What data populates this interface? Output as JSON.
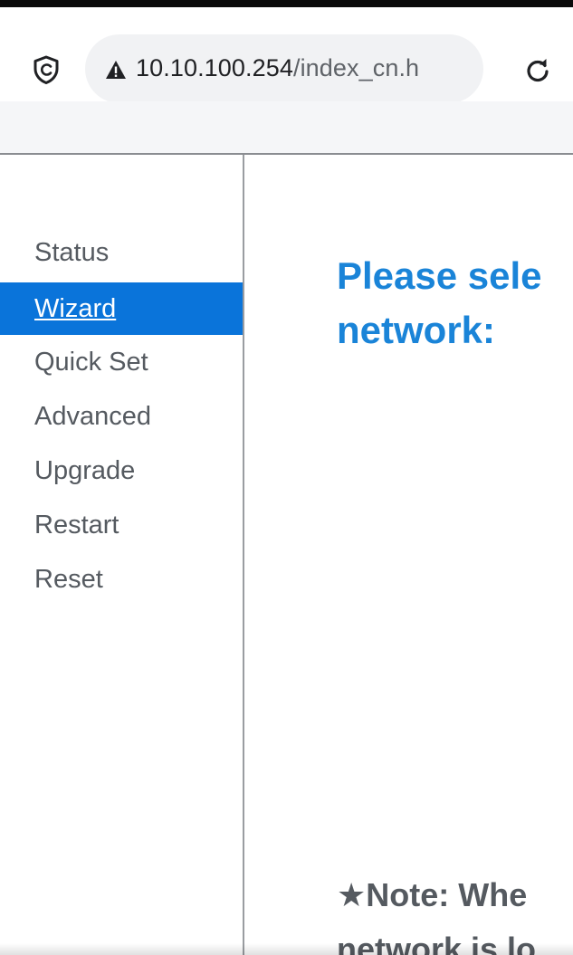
{
  "browser": {
    "url_host": "10.10.100.254",
    "url_path": "/index_cn.h",
    "security_icon": "shield-icon",
    "warning_icon": "warning-triangle-icon",
    "reload_icon": "reload-icon"
  },
  "sidebar": {
    "items": [
      {
        "label": "Status",
        "active": false
      },
      {
        "label": "Wizard",
        "active": true
      },
      {
        "label": "Quick Set",
        "active": false
      },
      {
        "label": "Advanced",
        "active": false
      },
      {
        "label": "Upgrade",
        "active": false
      },
      {
        "label": "Restart",
        "active": false
      },
      {
        "label": "Reset",
        "active": false
      }
    ]
  },
  "main": {
    "title_line1": "Please sele",
    "title_line2": "network:",
    "note_line1": "★Note: Whe",
    "note_line2": "network is lo"
  },
  "colors": {
    "accent": "#0a74da",
    "title": "#1a84d8",
    "text": "#555a60"
  }
}
